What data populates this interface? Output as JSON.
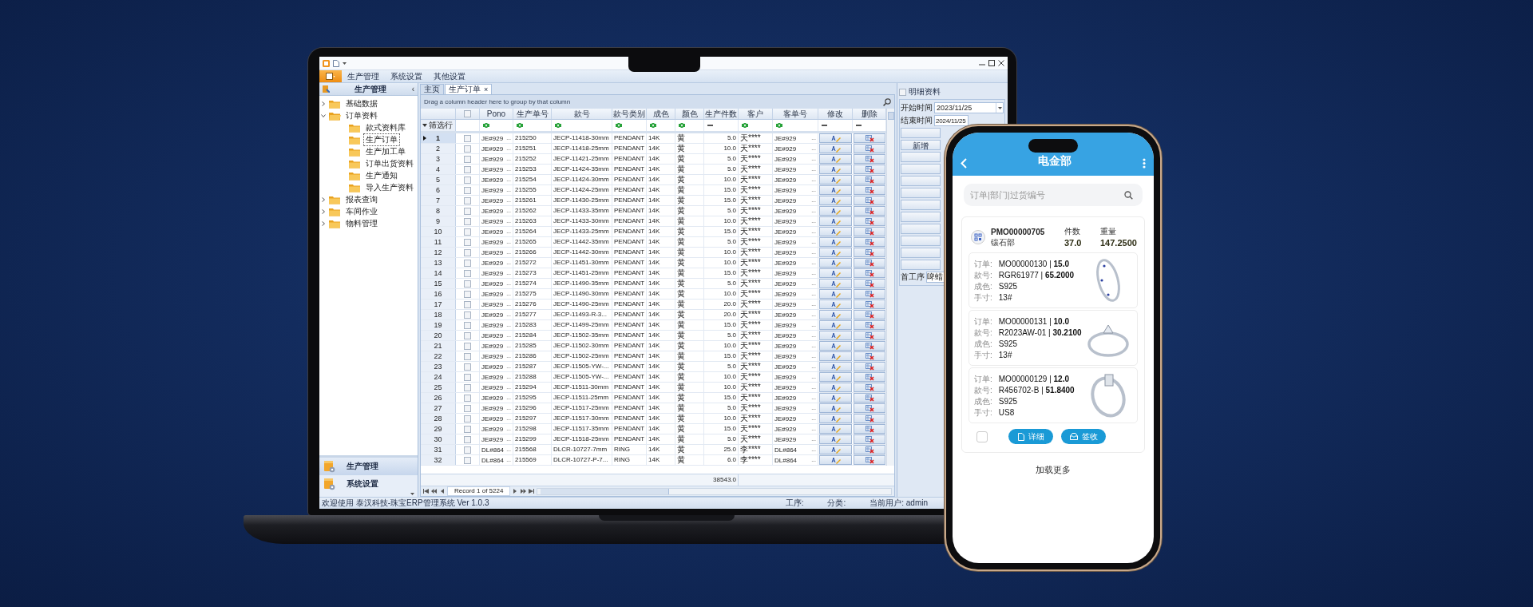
{
  "laptop": {
    "menu_bar": {
      "items": [
        {
          "label": "生产管理"
        },
        {
          "label": "系统设置"
        },
        {
          "label": "其他设置"
        }
      ]
    },
    "sidebar": {
      "title": "生产管理",
      "collapse_glyph": "‹",
      "tree": [
        {
          "label": "基础数据",
          "expanded": false,
          "selected": false
        },
        {
          "label": "订单资料",
          "expanded": true,
          "selected": false,
          "children": [
            {
              "label": "款式资料库",
              "selected": false
            },
            {
              "label": "生产订单",
              "selected": true
            },
            {
              "label": "生产加工单",
              "selected": false
            },
            {
              "label": "订单出货资料",
              "selected": false
            },
            {
              "label": "生产通知",
              "selected": false
            },
            {
              "label": "导入生产资料",
              "selected": false
            }
          ]
        },
        {
          "label": "报表查询",
          "expanded": false,
          "selected": false
        },
        {
          "label": "车间作业",
          "expanded": false,
          "selected": false
        },
        {
          "label": "物料管理",
          "expanded": false,
          "selected": false
        }
      ],
      "nav": [
        {
          "label": "生产管理",
          "selected": true
        },
        {
          "label": "系统设置",
          "selected": false
        }
      ]
    },
    "tabs": [
      {
        "label": "主页",
        "selected": false
      },
      {
        "label": "生产订单",
        "selected": true,
        "close": "×"
      }
    ],
    "grid": {
      "group_hint": "Drag a column header here to group by that column",
      "columns": [
        {
          "kind": "rownum",
          "filter_label": "筛选行"
        },
        {
          "kind": "checkbox",
          "checked": false
        },
        {
          "kind": "text",
          "title": "Pono"
        },
        {
          "kind": "text",
          "title": "生产单号"
        },
        {
          "kind": "text",
          "title": "款号"
        },
        {
          "kind": "text",
          "title": "款号类别"
        },
        {
          "kind": "text",
          "title": "成色"
        },
        {
          "kind": "text",
          "title": "颜色"
        },
        {
          "kind": "number",
          "title": "生产件数"
        },
        {
          "kind": "text",
          "title": "客户"
        },
        {
          "kind": "text",
          "title": "客单号"
        },
        {
          "kind": "action",
          "title": "修改"
        },
        {
          "kind": "action",
          "title": "删除"
        }
      ],
      "rows": [
        {
          "no": "1",
          "selected": true,
          "checked": false,
          "pono": "JE#929",
          "pono_btn": "...",
          "order_no": "215250",
          "style_no": "JECP-11418-30mm",
          "style_type": "PENDANT",
          "purity": "14K",
          "shade": "黄",
          "qty": "5.0",
          "customer": "天****",
          "cust_order": "JE#929",
          "cust_btn": "..."
        },
        {
          "no": "2",
          "selected": false,
          "checked": false,
          "pono": "JE#929",
          "pono_btn": "...",
          "order_no": "215251",
          "style_no": "JECP-11418-25mm",
          "style_type": "PENDANT",
          "purity": "14K",
          "shade": "黄",
          "qty": "10.0",
          "customer": "天****",
          "cust_order": "JE#929",
          "cust_btn": "..."
        },
        {
          "no": "3",
          "selected": false,
          "checked": false,
          "pono": "JE#929",
          "pono_btn": "...",
          "order_no": "215252",
          "style_no": "JECP-11421-25mm",
          "style_type": "PENDANT",
          "purity": "14K",
          "shade": "黄",
          "qty": "5.0",
          "customer": "天****",
          "cust_order": "JE#929",
          "cust_btn": "..."
        },
        {
          "no": "4",
          "selected": false,
          "checked": false,
          "pono": "JE#929",
          "pono_btn": "...",
          "order_no": "215253",
          "style_no": "JECP-11424-35mm",
          "style_type": "PENDANT",
          "purity": "14K",
          "shade": "黄",
          "qty": "5.0",
          "customer": "天****",
          "cust_order": "JE#929",
          "cust_btn": "..."
        },
        {
          "no": "5",
          "selected": false,
          "checked": false,
          "pono": "JE#929",
          "pono_btn": "...",
          "order_no": "215254",
          "style_no": "JECP-11424-30mm",
          "style_type": "PENDANT",
          "purity": "14K",
          "shade": "黄",
          "qty": "10.0",
          "customer": "天****",
          "cust_order": "JE#929",
          "cust_btn": "..."
        },
        {
          "no": "6",
          "selected": false,
          "checked": false,
          "pono": "JE#929",
          "pono_btn": "...",
          "order_no": "215255",
          "style_no": "JECP-11424-25mm",
          "style_type": "PENDANT",
          "purity": "14K",
          "shade": "黄",
          "qty": "15.0",
          "customer": "天****",
          "cust_order": "JE#929",
          "cust_btn": "..."
        },
        {
          "no": "7",
          "selected": false,
          "checked": false,
          "pono": "JE#929",
          "pono_btn": "...",
          "order_no": "215261",
          "style_no": "JECP-11430-25mm",
          "style_type": "PENDANT",
          "purity": "14K",
          "shade": "黄",
          "qty": "15.0",
          "customer": "天****",
          "cust_order": "JE#929",
          "cust_btn": "..."
        },
        {
          "no": "8",
          "selected": false,
          "checked": false,
          "pono": "JE#929",
          "pono_btn": "...",
          "order_no": "215262",
          "style_no": "JECP-11433-35mm",
          "style_type": "PENDANT",
          "purity": "14K",
          "shade": "黄",
          "qty": "5.0",
          "customer": "天****",
          "cust_order": "JE#929",
          "cust_btn": "..."
        },
        {
          "no": "9",
          "selected": false,
          "checked": false,
          "pono": "JE#929",
          "pono_btn": "...",
          "order_no": "215263",
          "style_no": "JECP-11433-30mm",
          "style_type": "PENDANT",
          "purity": "14K",
          "shade": "黄",
          "qty": "10.0",
          "customer": "天****",
          "cust_order": "JE#929",
          "cust_btn": "..."
        },
        {
          "no": "10",
          "selected": false,
          "checked": false,
          "pono": "JE#929",
          "pono_btn": "...",
          "order_no": "215264",
          "style_no": "JECP-11433-25mm",
          "style_type": "PENDANT",
          "purity": "14K",
          "shade": "黄",
          "qty": "15.0",
          "customer": "天****",
          "cust_order": "JE#929",
          "cust_btn": "..."
        },
        {
          "no": "11",
          "selected": false,
          "checked": false,
          "pono": "JE#929",
          "pono_btn": "...",
          "order_no": "215265",
          "style_no": "JECP-11442-35mm",
          "style_type": "PENDANT",
          "purity": "14K",
          "shade": "黄",
          "qty": "5.0",
          "customer": "天****",
          "cust_order": "JE#929",
          "cust_btn": "..."
        },
        {
          "no": "12",
          "selected": false,
          "checked": false,
          "pono": "JE#929",
          "pono_btn": "...",
          "order_no": "215266",
          "style_no": "JECP-11442-30mm",
          "style_type": "PENDANT",
          "purity": "14K",
          "shade": "黄",
          "qty": "10.0",
          "customer": "天****",
          "cust_order": "JE#929",
          "cust_btn": "..."
        },
        {
          "no": "13",
          "selected": false,
          "checked": false,
          "pono": "JE#929",
          "pono_btn": "...",
          "order_no": "215272",
          "style_no": "JECP-11451-30mm",
          "style_type": "PENDANT",
          "purity": "14K",
          "shade": "黄",
          "qty": "10.0",
          "customer": "天****",
          "cust_order": "JE#929",
          "cust_btn": "..."
        },
        {
          "no": "14",
          "selected": false,
          "checked": false,
          "pono": "JE#929",
          "pono_btn": "...",
          "order_no": "215273",
          "style_no": "JECP-11451-25mm",
          "style_type": "PENDANT",
          "purity": "14K",
          "shade": "黄",
          "qty": "15.0",
          "customer": "天****",
          "cust_order": "JE#929",
          "cust_btn": "..."
        },
        {
          "no": "15",
          "selected": false,
          "checked": false,
          "pono": "JE#929",
          "pono_btn": "...",
          "order_no": "215274",
          "style_no": "JECP-11490-35mm",
          "style_type": "PENDANT",
          "purity": "14K",
          "shade": "黄",
          "qty": "5.0",
          "customer": "天****",
          "cust_order": "JE#929",
          "cust_btn": "..."
        },
        {
          "no": "16",
          "selected": false,
          "checked": false,
          "pono": "JE#929",
          "pono_btn": "...",
          "order_no": "215275",
          "style_no": "JECP-11490-30mm",
          "style_type": "PENDANT",
          "purity": "14K",
          "shade": "黄",
          "qty": "10.0",
          "customer": "天****",
          "cust_order": "JE#929",
          "cust_btn": "..."
        },
        {
          "no": "17",
          "selected": false,
          "checked": false,
          "pono": "JE#929",
          "pono_btn": "...",
          "order_no": "215276",
          "style_no": "JECP-11490-25mm",
          "style_type": "PENDANT",
          "purity": "14K",
          "shade": "黄",
          "qty": "20.0",
          "customer": "天****",
          "cust_order": "JE#929",
          "cust_btn": "..."
        },
        {
          "no": "18",
          "selected": false,
          "checked": false,
          "pono": "JE#929",
          "pono_btn": "...",
          "order_no": "215277",
          "style_no": "JECP-11493-R-3...",
          "style_type": "PENDANT",
          "purity": "14K",
          "shade": "黄",
          "qty": "20.0",
          "customer": "天****",
          "cust_order": "JE#929",
          "cust_btn": "..."
        },
        {
          "no": "19",
          "selected": false,
          "checked": false,
          "pono": "JE#929",
          "pono_btn": "...",
          "order_no": "215283",
          "style_no": "JECP-11499-25mm",
          "style_type": "PENDANT",
          "purity": "14K",
          "shade": "黄",
          "qty": "15.0",
          "customer": "天****",
          "cust_order": "JE#929",
          "cust_btn": "..."
        },
        {
          "no": "20",
          "selected": false,
          "checked": false,
          "pono": "JE#929",
          "pono_btn": "...",
          "order_no": "215284",
          "style_no": "JECP-11502-35mm",
          "style_type": "PENDANT",
          "purity": "14K",
          "shade": "黄",
          "qty": "5.0",
          "customer": "天****",
          "cust_order": "JE#929",
          "cust_btn": "..."
        },
        {
          "no": "21",
          "selected": false,
          "checked": false,
          "pono": "JE#929",
          "pono_btn": "...",
          "order_no": "215285",
          "style_no": "JECP-11502-30mm",
          "style_type": "PENDANT",
          "purity": "14K",
          "shade": "黄",
          "qty": "10.0",
          "customer": "天****",
          "cust_order": "JE#929",
          "cust_btn": "..."
        },
        {
          "no": "22",
          "selected": false,
          "checked": false,
          "pono": "JE#929",
          "pono_btn": "...",
          "order_no": "215286",
          "style_no": "JECP-11502-25mm",
          "style_type": "PENDANT",
          "purity": "14K",
          "shade": "黄",
          "qty": "15.0",
          "customer": "天****",
          "cust_order": "JE#929",
          "cust_btn": "..."
        },
        {
          "no": "23",
          "selected": false,
          "checked": false,
          "pono": "JE#929",
          "pono_btn": "...",
          "order_no": "215287",
          "style_no": "JECP-11505-YW-...",
          "style_type": "PENDANT",
          "purity": "14K",
          "shade": "黄",
          "qty": "5.0",
          "customer": "天****",
          "cust_order": "JE#929",
          "cust_btn": "..."
        },
        {
          "no": "24",
          "selected": false,
          "checked": false,
          "pono": "JE#929",
          "pono_btn": "...",
          "order_no": "215288",
          "style_no": "JECP-11505-YW-...",
          "style_type": "PENDANT",
          "purity": "14K",
          "shade": "黄",
          "qty": "10.0",
          "customer": "天****",
          "cust_order": "JE#929",
          "cust_btn": "..."
        },
        {
          "no": "25",
          "selected": false,
          "checked": false,
          "pono": "JE#929",
          "pono_btn": "...",
          "order_no": "215294",
          "style_no": "JECP-11511-30mm",
          "style_type": "PENDANT",
          "purity": "14K",
          "shade": "黄",
          "qty": "10.0",
          "customer": "天****",
          "cust_order": "JE#929",
          "cust_btn": "..."
        },
        {
          "no": "26",
          "selected": false,
          "checked": false,
          "pono": "JE#929",
          "pono_btn": "...",
          "order_no": "215295",
          "style_no": "JECP-11511-25mm",
          "style_type": "PENDANT",
          "purity": "14K",
          "shade": "黄",
          "qty": "15.0",
          "customer": "天****",
          "cust_order": "JE#929",
          "cust_btn": "..."
        },
        {
          "no": "27",
          "selected": false,
          "checked": false,
          "pono": "JE#929",
          "pono_btn": "...",
          "order_no": "215296",
          "style_no": "JECP-11517-25mm",
          "style_type": "PENDANT",
          "purity": "14K",
          "shade": "黄",
          "qty": "5.0",
          "customer": "天****",
          "cust_order": "JE#929",
          "cust_btn": "..."
        },
        {
          "no": "28",
          "selected": false,
          "checked": false,
          "pono": "JE#929",
          "pono_btn": "...",
          "order_no": "215297",
          "style_no": "JECP-11517-30mm",
          "style_type": "PENDANT",
          "purity": "14K",
          "shade": "黄",
          "qty": "10.0",
          "customer": "天****",
          "cust_order": "JE#929",
          "cust_btn": "..."
        },
        {
          "no": "29",
          "selected": false,
          "checked": false,
          "pono": "JE#929",
          "pono_btn": "...",
          "order_no": "215298",
          "style_no": "JECP-11517-35mm",
          "style_type": "PENDANT",
          "purity": "14K",
          "shade": "黄",
          "qty": "15.0",
          "customer": "天****",
          "cust_order": "JE#929",
          "cust_btn": "..."
        },
        {
          "no": "30",
          "selected": false,
          "checked": false,
          "pono": "JE#929",
          "pono_btn": "...",
          "order_no": "215299",
          "style_no": "JECP-11518-25mm",
          "style_type": "PENDANT",
          "purity": "14K",
          "shade": "黄",
          "qty": "5.0",
          "customer": "天****",
          "cust_order": "JE#929",
          "cust_btn": "..."
        },
        {
          "no": "31",
          "selected": false,
          "checked": false,
          "pono": "DL#864",
          "pono_btn": "...",
          "order_no": "215568",
          "style_no": "DLCR-10727-7mm",
          "style_type": "RING",
          "purity": "14K",
          "shade": "黄",
          "qty": "25.0",
          "customer": "李****",
          "cust_order": "DL#864",
          "cust_btn": "..."
        },
        {
          "no": "32",
          "selected": false,
          "checked": false,
          "pono": "DL#864",
          "pono_btn": "...",
          "order_no": "215569",
          "style_no": "DLCR-10727-P-7...",
          "style_type": "RING",
          "purity": "14K",
          "shade": "黄",
          "qty": "6.0",
          "customer": "李****",
          "cust_order": "DL#864",
          "cust_btn": "..."
        }
      ],
      "total": "38543.0",
      "record": "Record 1 of 5224"
    },
    "details": {
      "title": "明细资料",
      "checked": false,
      "start_label": "开始时间",
      "start_value": "2023/11/25",
      "end_label": "结束时间",
      "end_value": "2024/11/25",
      "add_button": "新增",
      "process_label": "首工序",
      "process_value": "啤蜡"
    },
    "status_bar": {
      "welcome": "欢迎使用  泰汉科技-珠宝ERP管理系统 Ver 1.0.3",
      "process": "工序:",
      "category": "分类:",
      "user": "当前用户: admin"
    }
  },
  "phone": {
    "title": "电金部",
    "search": {
      "placeholder": "订单|部门|过货编号"
    },
    "order": {
      "number": "PMO00000705",
      "department": "镶石部",
      "qty_label": "件数",
      "qty": "37.0",
      "weight_label": "重量",
      "weight": "147.2500",
      "checked": false,
      "items": [
        {
          "fields": [
            {
              "label": "订单:",
              "value": "MO00000130 | **15.0**"
            },
            {
              "label": "款号:",
              "value": "RGR61977 | **65.2000**"
            },
            {
              "label": "成色:",
              "value": "S925"
            },
            {
              "label": "手寸:",
              "value": "13#"
            }
          ]
        },
        {
          "fields": [
            {
              "label": "订单:",
              "value": "MO00000131 | **10.0**"
            },
            {
              "label": "款号:",
              "value": "R2023AW-01 | **30.2100**"
            },
            {
              "label": "成色:",
              "value": "S925"
            },
            {
              "label": "手寸:",
              "value": "13#"
            }
          ]
        },
        {
          "fields": [
            {
              "label": "订单:",
              "value": "MO00000129 | **12.0**"
            },
            {
              "label": "款号:",
              "value": "R456702-B | **51.8400**"
            },
            {
              "label": "成色:",
              "value": "S925"
            },
            {
              "label": "手寸:",
              "value": "US8"
            }
          ]
        }
      ],
      "buttons": [
        {
          "label": "详细",
          "kind": "detail"
        },
        {
          "label": "签收",
          "kind": "receive"
        }
      ]
    },
    "load_more": "加载更多"
  }
}
